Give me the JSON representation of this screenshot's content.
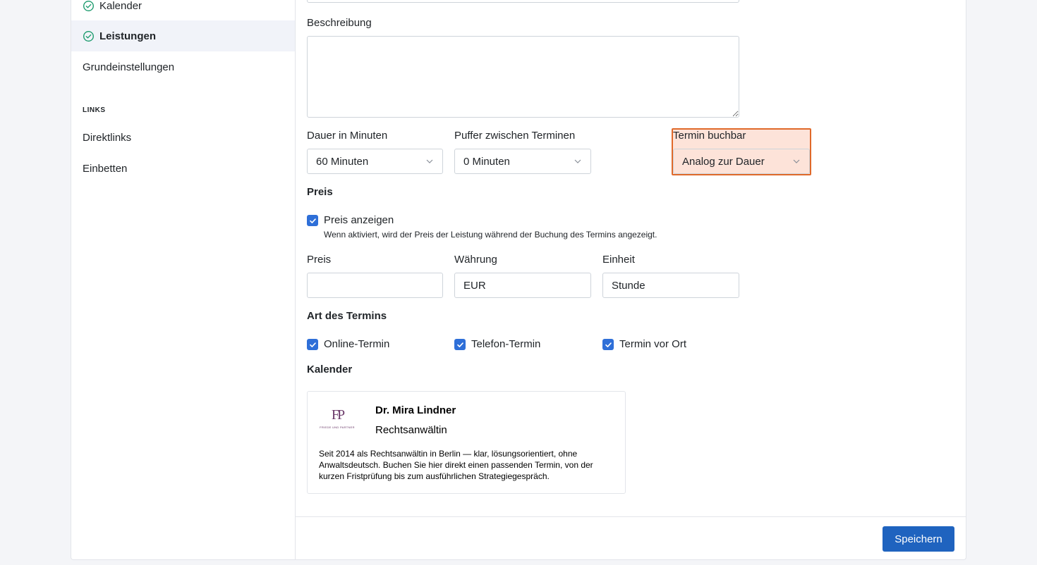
{
  "sidebar": {
    "items": [
      {
        "label": "Kalender",
        "icon": "check-circle-icon"
      },
      {
        "label": "Leistungen",
        "icon": "check-circle-icon"
      },
      {
        "label": "Grundeinstellungen"
      }
    ],
    "links_title": "LINKS",
    "links": [
      {
        "label": "Direktlinks"
      },
      {
        "label": "Einbetten"
      }
    ]
  },
  "form": {
    "description_label": "Beschreibung",
    "description_value": "",
    "duration_label": "Dauer in Minuten",
    "duration_value": "60 Minuten",
    "buffer_label": "Puffer zwischen Terminen",
    "buffer_value": "0 Minuten",
    "bookable_label": "Termin buchbar",
    "bookable_value": "Analog zur Dauer",
    "price_heading": "Preis",
    "show_price_label": "Preis anzeigen",
    "show_price_help": "Wenn aktiviert, wird der Preis der Leistung während der Buchung des Termins angezeigt.",
    "price_label": "Preis",
    "price_value": "",
    "currency_label": "Währung",
    "currency_value": "EUR",
    "unit_label": "Einheit",
    "unit_value": "Stunde",
    "type_heading": "Art des Termins",
    "type_online": "Online-Termin",
    "type_phone": "Telefon-Termin",
    "type_onsite": "Termin vor Ort",
    "calendar_heading": "Kalender"
  },
  "card": {
    "logo_monogram": "FP",
    "logo_subtext": "FRIEDE UND PARTNER",
    "name": "Dr. Mira Lindner",
    "role": "Rechtsanwältin",
    "description": "Seit 2014 als Rechtsanwältin in Berlin — klar, lösungsorientiert, ohne Anwaltsdeutsch. Buchen Sie hier direkt einen passenden Termin, von der kurzen Fristprüfung bis zum ausführlichen Strategiegespräch."
  },
  "footer": {
    "save_label": "Speichern"
  },
  "colors": {
    "accent": "#1f63bf",
    "checkbox": "#2e6fd8",
    "success": "#1a9a6c",
    "highlight_bg": "#fde3d9",
    "highlight_border": "#e0692a"
  }
}
